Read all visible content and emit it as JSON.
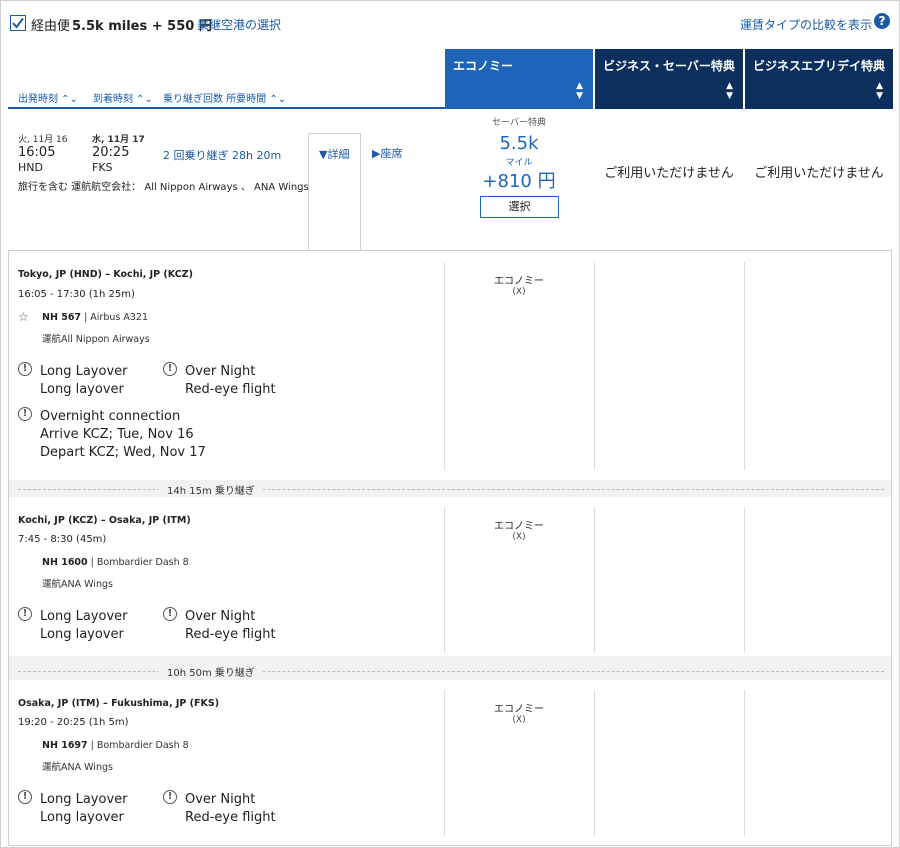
{
  "top": {
    "checkbox_label": "経由便",
    "miles_price": "5.5k miles + 550 円",
    "airport_link": "乗継空港の選択",
    "compare_link": "運賃タイプの比較を表示",
    "help": "?"
  },
  "sort": [
    "出発時刻 ⌃⌄",
    "到着時刻 ⌃⌄",
    "乗り継ぎ回数 所要時間 ⌃⌄"
  ],
  "cabins": [
    {
      "label": "エコノミー",
      "caret": "▲▼"
    },
    {
      "label": "ビジネス・セーバー特典",
      "caret": "▲▼"
    },
    {
      "label": "ビジネスエブリデイ特典",
      "caret": "▲▼"
    }
  ],
  "summary": {
    "dep_date": "火, 11月 16",
    "dep_time": "16:05",
    "dep_airport": "HND",
    "arr_date": "水, 11月 17",
    "arr_time": "20:25",
    "arr_airport": "FKS",
    "stops": "2 回乗り継ぎ  28h 20m",
    "operated": "旅行を含む 運航航空会社： All Nippon Airways 、 ANA Wings",
    "details": "▼詳細",
    "seats": "▶座席"
  },
  "fare": {
    "saver_label": "セーバー特典",
    "miles": "5.5k",
    "miles_unit": "マイル",
    "price": "+810 円",
    "select": "選択",
    "business_saver": "ご利用いただけません",
    "business_everyday": "ご利用いただけません"
  },
  "segments": [
    {
      "route": "Tokyo, JP (HND)  –  Kochi, JP (KCZ)",
      "time": "16:05 - 17:30 (1h 25m)",
      "flight_no": "NH 567",
      "aircraft": " | Airbus A321",
      "operated": "運航All Nippon Airways",
      "cabin": "エコノミー",
      "cabin_code": "(X)",
      "warnings": [
        {
          "title": "Long Layover",
          "desc": "Long layover"
        },
        {
          "title": "Over Night",
          "desc": "Red-eye flight"
        },
        {
          "title": "Overnight connection",
          "desc": "Arrive KCZ; Tue, Nov 16",
          "desc2": "Depart KCZ; Wed, Nov 17"
        }
      ]
    },
    {
      "route": "Kochi, JP (KCZ)  –  Osaka, JP (ITM)",
      "time": "7:45 - 8:30 (45m)",
      "flight_no": "NH 1600",
      "aircraft": " | Bombardier Dash 8",
      "operated": "運航ANA Wings",
      "cabin": "エコノミー",
      "cabin_code": "(X)",
      "warnings": [
        {
          "title": "Long Layover",
          "desc": "Long layover"
        },
        {
          "title": "Over Night",
          "desc": "Red-eye flight"
        }
      ]
    },
    {
      "route": "Osaka, JP (ITM)  –  Fukushima, JP (FKS)",
      "time": "19:20 - 20:25 (1h 5m)",
      "flight_no": "NH 1697",
      "aircraft": " | Bombardier Dash 8",
      "operated": "運航ANA Wings",
      "cabin": "エコノミー",
      "cabin_code": "(X)",
      "warnings": [
        {
          "title": "Long Layover",
          "desc": "Long layover"
        },
        {
          "title": "Over Night",
          "desc": "Red-eye flight"
        }
      ]
    }
  ],
  "connections": [
    "14h 15m 乗り継ぎ",
    "10h 50m 乗り継ぎ"
  ],
  "colors": {
    "accent": "#1e64b8",
    "navy": "#0c2f5e",
    "link": "#1a5aa8"
  }
}
